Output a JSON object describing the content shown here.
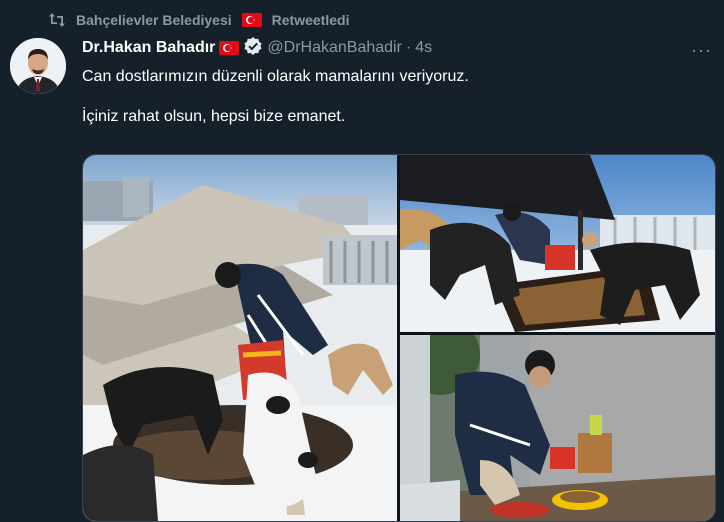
{
  "retweet": {
    "icon": "retweet-icon",
    "account": "Bahçelievler Belediyesi",
    "label": "Retweetledi"
  },
  "tweet": {
    "author": {
      "display_name": "Dr.Hakan Bahadır",
      "handle": "@DrHakanBahadir",
      "verified": true
    },
    "separator": "·",
    "time": "4s",
    "paragraphs": [
      "Can dostlarımızın düzenli olarak mamalarını veriyoruz.",
      "İçiniz rahat olsun, hepsi bize emanet."
    ],
    "more_label": "···"
  },
  "colors": {
    "background": "#15202b",
    "text": "#ffffff",
    "muted": "#8b98a5",
    "flag": "#e30a17"
  },
  "media": {
    "count": 3
  }
}
